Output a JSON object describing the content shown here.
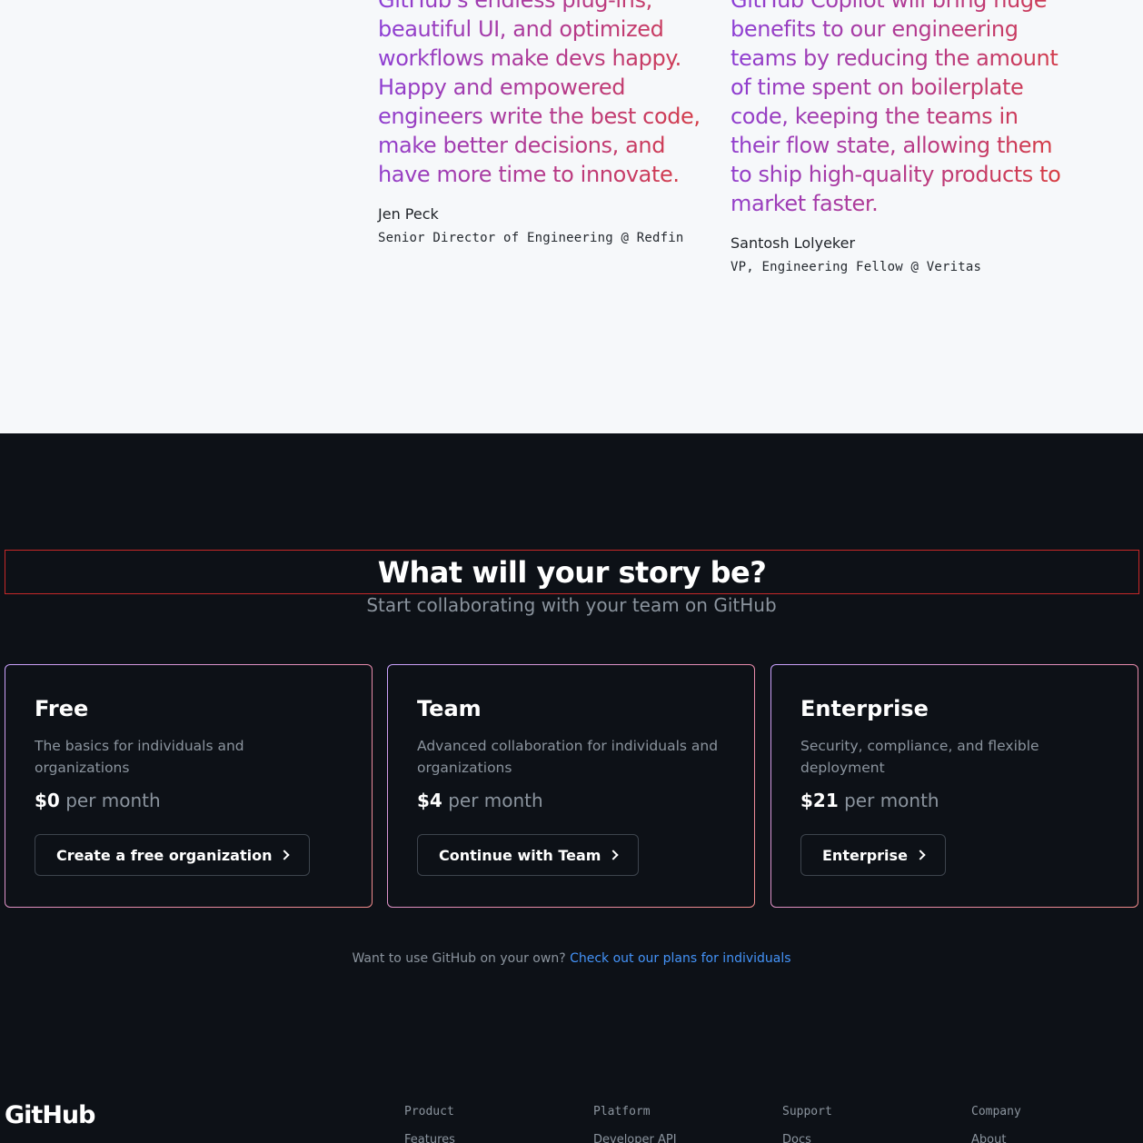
{
  "testimonials": [
    {
      "quote": "GitHub's endless plug-ins, beautiful UI, and optimized workflows make devs happy. Happy and empowered engineers write the best code, make better decisions, and have more time to innovate.",
      "author": "Jen Peck",
      "role": "Senior Director of Engineering @ Redfin"
    },
    {
      "quote": "GitHub Copilot will bring huge benefits to our engineering teams by reducing the amount of time spent on boilerplate code, keeping the teams in their flow state, allowing them to ship high-quality products to market faster.",
      "author": "Santosh Lolyeker",
      "role": "VP, Engineering Fellow @ Veritas"
    }
  ],
  "cta": {
    "heading": "What will your story be?",
    "subheading": "Start collaborating with your team on GitHub"
  },
  "plans": [
    {
      "name": "Free",
      "description": "The basics for individuals and organizations",
      "price": "$0",
      "period": "per month",
      "button": "Create a free organization"
    },
    {
      "name": "Team",
      "description": "Advanced collaboration for individuals and organizations",
      "price": "$4",
      "period": "per month",
      "button": "Continue with Team"
    },
    {
      "name": "Enterprise",
      "description": "Security, compliance, and flexible deployment",
      "price": "$21",
      "period": "per month",
      "button": "Enterprise"
    }
  ],
  "individuals": {
    "prompt": "Want to use GitHub on your own?",
    "link": "Check out our plans for individuals"
  },
  "footer": {
    "logo": "GitHub",
    "columns": [
      {
        "heading": "Product",
        "first_link": "Features"
      },
      {
        "heading": "Platform",
        "first_link": "Developer API"
      },
      {
        "heading": "Support",
        "first_link": "Docs"
      },
      {
        "heading": "Company",
        "first_link": "About"
      }
    ]
  },
  "colors": {
    "dark_bg": "#0d1117",
    "light_bg": "#f6f8fa",
    "link_blue": "#4493f8",
    "muted_text": "#8b949e",
    "quote_gradient_start": "#8b3fd9",
    "quote_gradient_end": "#d93c3c"
  }
}
